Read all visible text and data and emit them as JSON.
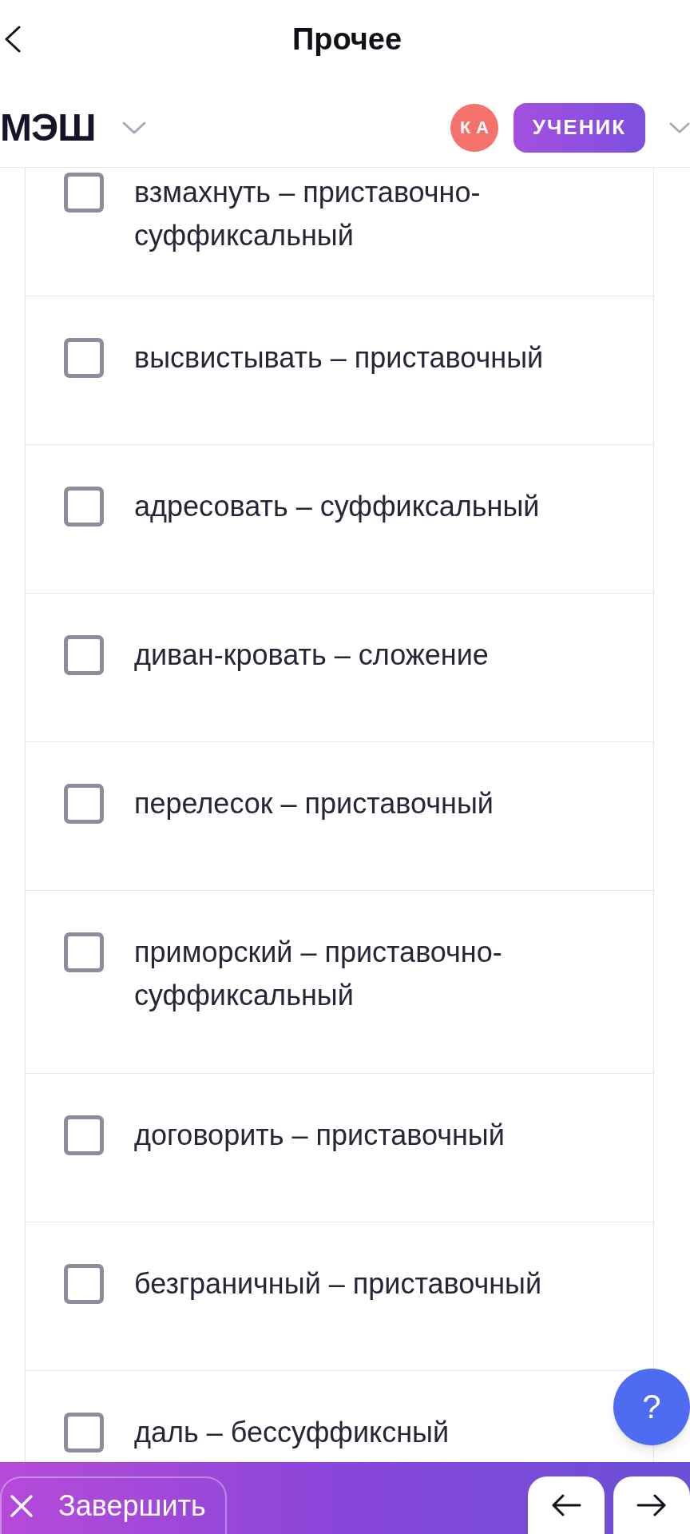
{
  "top_bar": {
    "title": "Прочее"
  },
  "header": {
    "logo": "МЭШ",
    "avatar": {
      "initials": "КА"
    },
    "role_button": "УЧЕНИК"
  },
  "options": [
    {
      "text": "взмахнуть – приставочно-суффиксальный",
      "checked": false
    },
    {
      "text": "высвистывать – приставочный",
      "checked": false
    },
    {
      "text": "адресовать – суффиксальный",
      "checked": false
    },
    {
      "text": "диван-кровать – сложение",
      "checked": false
    },
    {
      "text": "перелесок – приставочный",
      "checked": false
    },
    {
      "text": "приморский – приставочно-суффиксальный",
      "checked": false
    },
    {
      "text": "договорить – приставочный",
      "checked": false
    },
    {
      "text": "безграничный – приставочный",
      "checked": false
    },
    {
      "text": "даль – бессуффиксный",
      "checked": false
    }
  ],
  "help_button": {
    "label": "?"
  },
  "bottom_bar": {
    "finish_button": "Завершить"
  }
}
